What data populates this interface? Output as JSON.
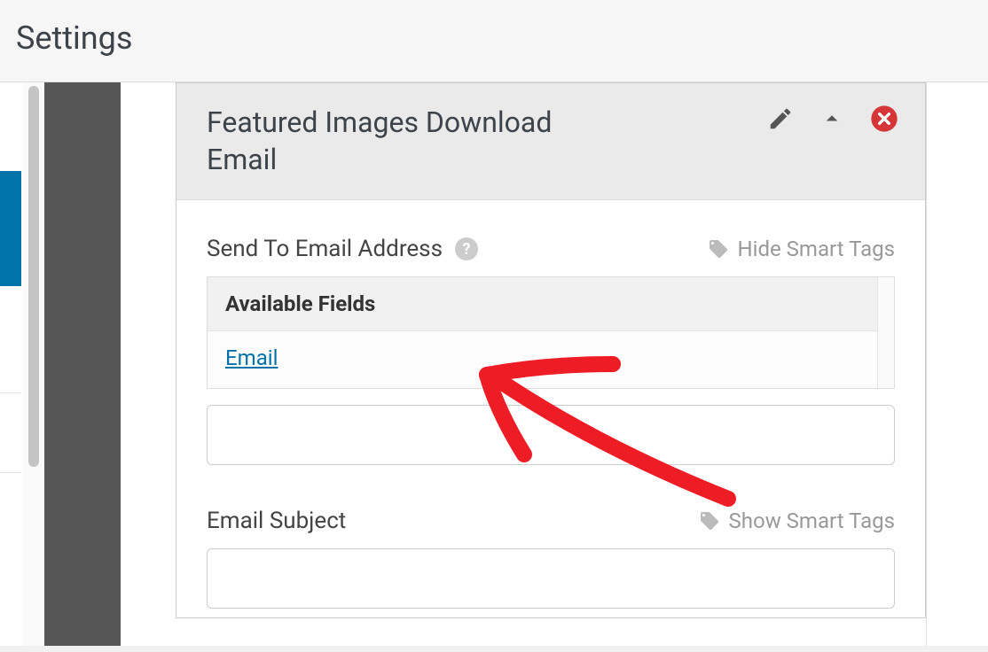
{
  "header": {
    "title": "Settings"
  },
  "notification": {
    "panel_title": "Featured Images Download Email",
    "send_to": {
      "label": "Send To Email Address",
      "smart_tags_toggle": "Hide Smart Tags",
      "available_fields_title": "Available Fields",
      "fields": {
        "email": "Email"
      },
      "value": ""
    },
    "subject": {
      "label": "Email Subject",
      "smart_tags_toggle": "Show Smart Tags",
      "value": ""
    }
  }
}
